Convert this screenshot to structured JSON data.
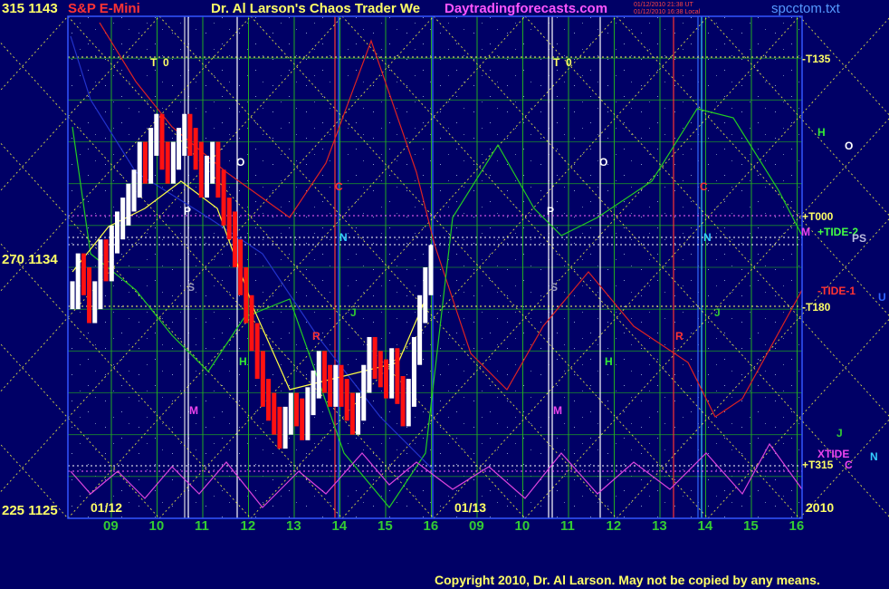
{
  "header": {
    "left_label": "315 1143",
    "symbol": "S&P E-Mini",
    "title": "Dr. Al Larson's Chaos Trader We",
    "site": "Daytradingforecasts.com",
    "stamp_line1": "01/12/2010 21:38 UT",
    "stamp_line2": "01/12/2010 16:38 Local",
    "file": "spcctom.txt"
  },
  "y_labels": {
    "top": "315 1143",
    "mid": "270 1134",
    "bottom": "225 1125"
  },
  "dates": {
    "left": "01/12",
    "middle": "01/13",
    "year": "2010"
  },
  "copyright": "Copyright 2010, Dr. Al Larson. May not be copied by any means.",
  "right_labels": {
    "t135": "-T135",
    "t000": "+T000",
    "tide2": "+TIDE-2",
    "ps": "PS",
    "tide1": "-TIDE-1",
    "u": "U",
    "t180": "-T180",
    "xtide": "XTIDE",
    "n": "N",
    "t315": "+T315",
    "c": "C",
    "m": "M",
    "h": "H",
    "o": "O",
    "j": "J"
  },
  "colors": {
    "background": "#000066",
    "grid": "#22aa22",
    "price_up": "#ffffff",
    "price_down": "#ff1111",
    "axis_label": "#ffff66",
    "green_line": "#22cc22",
    "red_line": "#dd2222",
    "magenta_line": "#dd44dd",
    "yellow_line": "#ffff55"
  },
  "chart_data": {
    "type": "line",
    "title": "S&P E-Mini",
    "y_left_labels": [
      "315",
      "270",
      "225"
    ],
    "ylim": [
      1125,
      1143
    ],
    "x_tick_labels": [
      "09",
      "10",
      "11",
      "12",
      "13",
      "14",
      "15",
      "16",
      "09",
      "10",
      "11",
      "12",
      "13",
      "14",
      "15",
      "16"
    ],
    "sessions": [
      "01/12",
      "01/13"
    ],
    "series": [
      {
        "kind": "price_bars",
        "values": [
          1133,
          1134,
          1133.5,
          1132.5,
          1133,
          1134.5,
          1134,
          1135,
          1135.5,
          1136,
          1136.5,
          1137,
          1138,
          1137.5,
          1138.5,
          1139,
          1138,
          1137.5,
          1138,
          1138.5,
          1139,
          1138.5,
          1138,
          1137,
          1137.5,
          1138,
          1137,
          1136,
          1135.5,
          1134.5,
          1133.5,
          1132.5,
          1131.5,
          1130.5,
          1129.5,
          1129,
          1128.5,
          1128,
          1128.5,
          1129,
          1128.8,
          1128.3,
          1129.2,
          1129.8,
          1130.5,
          1130,
          1129.5,
          1130,
          1129.5,
          1129,
          1128.5,
          1129,
          1130,
          1131,
          1130.5,
          1130.2,
          1129.8,
          1130.6,
          1129.6,
          1128.8,
          1129.5,
          1131,
          1132.5,
          1133.5,
          1134.3
        ]
      }
    ]
  }
}
